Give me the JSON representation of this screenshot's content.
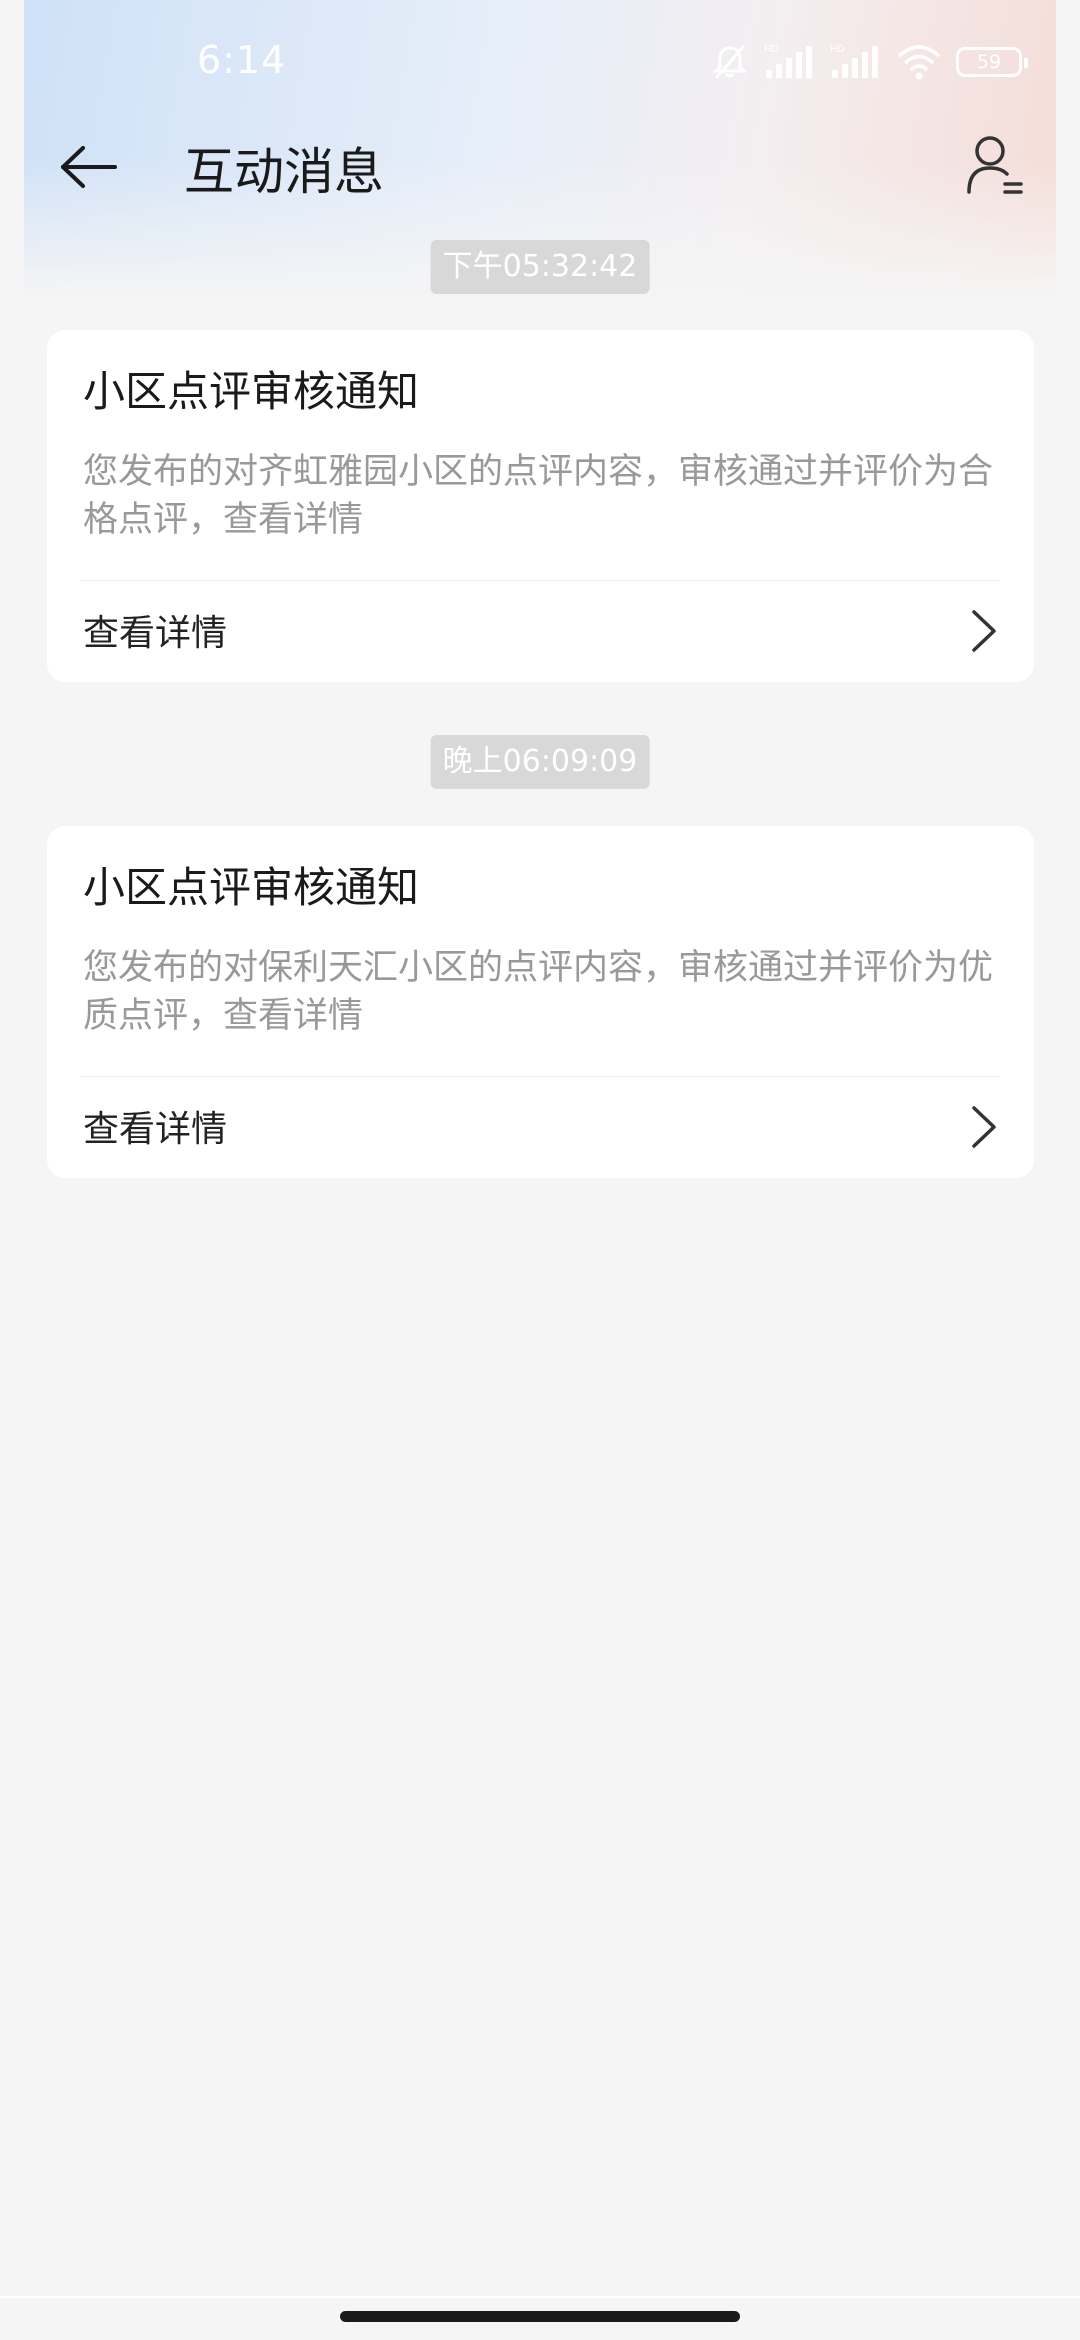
{
  "status_bar": {
    "time": "6:14",
    "battery_level": "59",
    "icons": [
      "mute-icon",
      "signal-hd-icon",
      "signal-hd-icon",
      "wifi-icon",
      "battery-icon"
    ]
  },
  "header": {
    "title": "互动消息",
    "back_icon": "back-arrow-icon",
    "profile_icon": "user-list-icon"
  },
  "messages": [
    {
      "timestamp": "下午05:32:42",
      "title": "小区点评审核通知",
      "body": "您发布的对齐虹雅园小区的点评内容，审核通过并评价为合格点评，查看详情",
      "link_label": "查看详情"
    },
    {
      "timestamp": "晚上06:09:09",
      "title": "小区点评审核通知",
      "body": "您发布的对保利天汇小区的点评内容，审核通过并评价为优质点评，查看详情",
      "link_label": "查看详情"
    }
  ],
  "colors": {
    "background": "#f5f5f5",
    "card": "#ffffff",
    "timestamp_bg": "#d8d8d8",
    "secondary_text": "#999999"
  }
}
